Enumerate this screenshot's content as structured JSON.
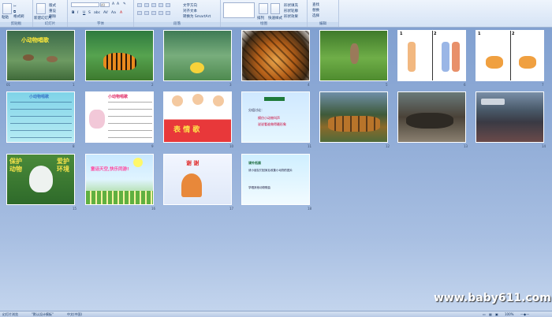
{
  "ribbon": {
    "groups": [
      {
        "label": "剪贴板"
      },
      {
        "label": "幻灯片"
      },
      {
        "label": "字体"
      },
      {
        "label": "段落"
      },
      {
        "label": "绘图"
      },
      {
        "label": "编辑"
      }
    ],
    "clipboard": {
      "paste": "粘贴",
      "format_painter": "格式刷"
    },
    "slides": {
      "new_slide": "新建幻灯片",
      "layout": "版式",
      "reset": "重设",
      "delete": "删除"
    },
    "font": {
      "size": "40"
    },
    "paragraph": {
      "text_direction": "文字方向",
      "align_text": "对齐文本",
      "smartart": "转换为 SmartArt"
    },
    "drawing": {
      "arrange": "排列",
      "quick_styles": "快速样式",
      "fill": "形状填充",
      "outline": "形状轮廓",
      "effects": "形状效果"
    },
    "editing": {
      "find": "查找",
      "replace": "替换",
      "select": "选择"
    }
  },
  "slides": [
    {
      "num": "1",
      "title": "小动物唱歌"
    },
    {
      "num": "2"
    },
    {
      "num": "3"
    },
    {
      "num": "4"
    },
    {
      "num": "5"
    },
    {
      "num": "6"
    },
    {
      "num": "7"
    },
    {
      "num": "8",
      "title": "小动物唱歌"
    },
    {
      "num": "9",
      "title": "小动物唱歌"
    },
    {
      "num": "10",
      "title": "表 情 歌"
    },
    {
      "num": "11",
      "lines": [
        "分组讨论：",
        "模仿小动物叫声",
        "说说看谁做得最形象"
      ]
    },
    {
      "num": "12"
    },
    {
      "num": "13"
    },
    {
      "num": "14"
    },
    {
      "num": "15",
      "left": "保护动物",
      "right": "爱护环境"
    },
    {
      "num": "16",
      "title": "童话天空,快乐同游!"
    },
    {
      "num": "17",
      "title": "谢 谢"
    },
    {
      "num": "18",
      "title": "课外拓展",
      "lines": [
        "请小朋友们回家后收集小动物的图片",
        "学唱其他动物歌曲"
      ]
    }
  ],
  "statusbar": {
    "slide_view": "幻灯片浏览",
    "theme": "\"默认设计模板\"",
    "language": "中文(中国)",
    "zoom": "100%"
  },
  "watermark": "www.baby611.com"
}
